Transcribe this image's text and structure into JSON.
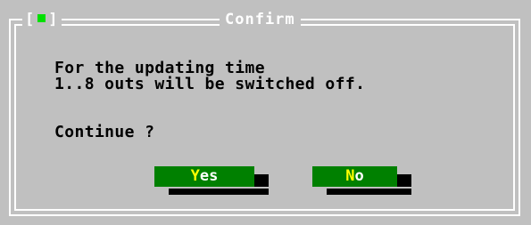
{
  "dialog": {
    "title": "Confirm",
    "close_box": {
      "left": "[",
      "right": "]"
    },
    "message_lines": [
      "For the updating time",
      "1..8 outs will be switched off.",
      "Continue ?"
    ],
    "buttons": {
      "yes": {
        "hotkey": "Y",
        "rest": "es"
      },
      "no": {
        "hotkey": "N",
        "rest": "o"
      }
    }
  },
  "colors": {
    "window_bg": "#c0c0c0",
    "border": "#ffffff",
    "button_bg": "#008000",
    "button_text": "#ffffff",
    "hotkey": "#ffff00",
    "close_indicator": "#00e000",
    "text": "#000000"
  }
}
